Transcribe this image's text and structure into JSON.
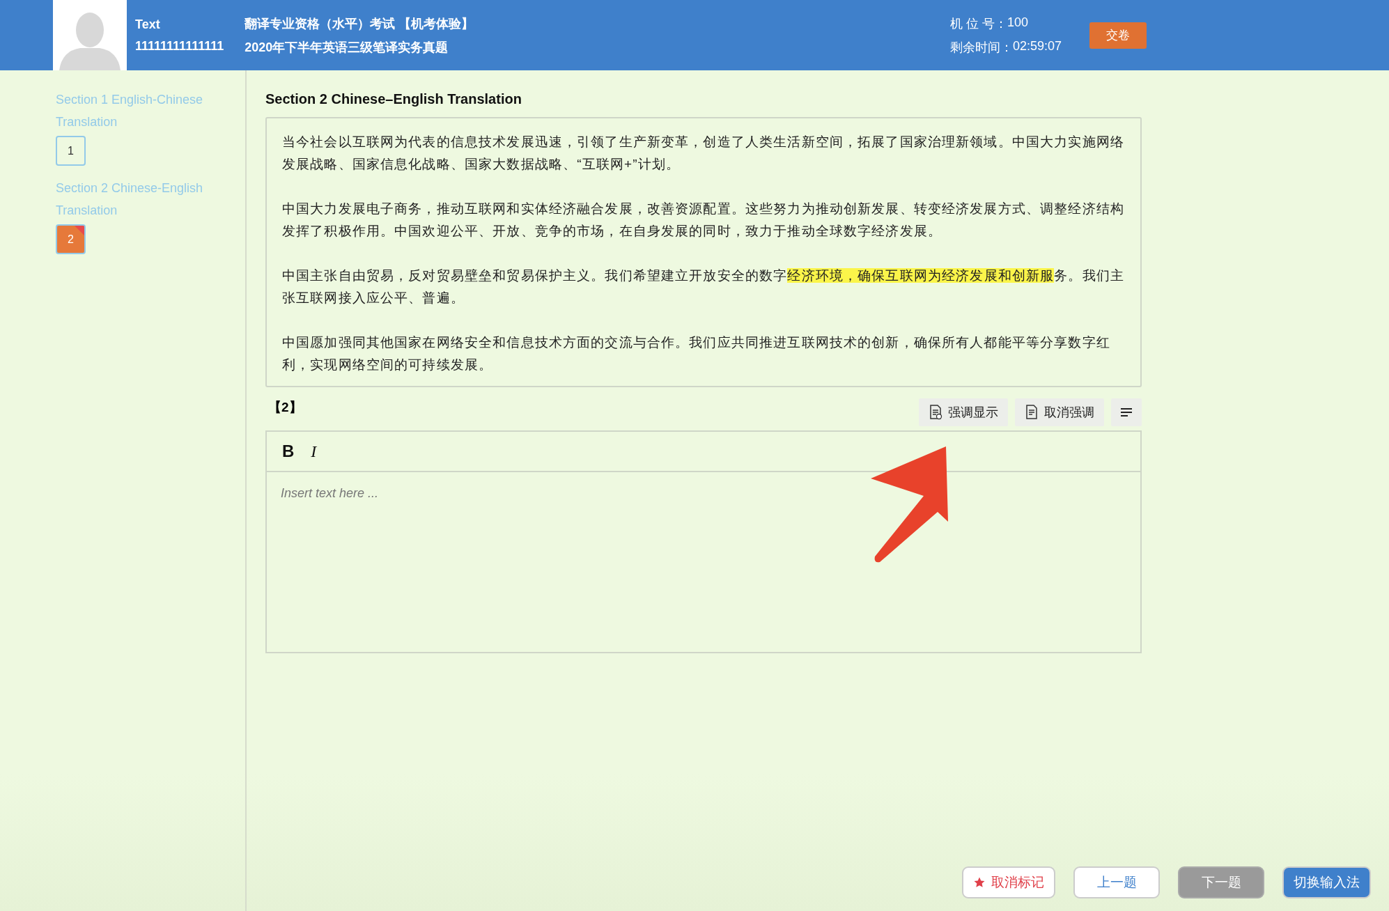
{
  "header": {
    "candidate_name": "Text",
    "candidate_id": "11111111111111",
    "exam_title": "翻译专业资格（水平）考试 【机考体验】",
    "paper_title": "2020年下半年英语三级笔译实务真题",
    "seat_label": "机 位 号：",
    "seat_number": "100",
    "time_label": "剩余时间：",
    "time_left": "02:59:07",
    "submit_button": "交卷"
  },
  "sidebar": {
    "sections": [
      {
        "title": "Section 1 English-Chinese Translation",
        "questions": [
          {
            "label": "1",
            "selected": false,
            "flagged": false
          }
        ]
      },
      {
        "title": "Section 2 Chinese-English Translation",
        "questions": [
          {
            "label": "2",
            "selected": true,
            "flagged": true
          }
        ]
      }
    ]
  },
  "question": {
    "section_title": "Section 2 Chinese–English Translation",
    "paragraphs": [
      [
        {
          "text": "当今社会以互联网为代表的信息技术发展迅速，引领了生产新变革，创造了人类生活新空间，拓展了国家治理新领域。中国大力实施网络发展战略、国家信息化战略、国家大数据战略、“互联网+”计划。",
          "highlighted": false
        }
      ],
      [
        {
          "text": "中国大力发展电子商务，推动互联网和实体经济融合发展，改善资源配置。这些努力为推动创新发展、转变经济发展方式、调整经济结构发挥了积极作用。中国欢迎公平、开放、竞争的市场，在自身发展的同时，致力于推动全球数字经济发展。",
          "highlighted": false
        }
      ],
      [
        {
          "text": "中国主张自由贸易，反对贸易壁垒和贸易保护主义。我们希望建立开放安全的数字",
          "highlighted": false
        },
        {
          "text": "经济环境，确保互联网为经济发展和创新服",
          "highlighted": true
        },
        {
          "text": "务。我们主张互联网接入应公平、普遍。",
          "highlighted": false
        }
      ],
      [
        {
          "text": "中国愿加强同其他国家在网络安全和信息技术方面的交流与合作。我们应共同推进互联网技术的创新，确保所有人都能平等分享数字红利，实现网络空间的可持续发展。",
          "highlighted": false
        }
      ]
    ],
    "answer_label": "【2】",
    "tools": [
      {
        "kind": "highlight",
        "label": "强调显示"
      },
      {
        "kind": "unhighlight",
        "label": "取消强调"
      },
      {
        "kind": "align"
      }
    ],
    "editor": {
      "format_buttons": [
        {
          "kind": "bold",
          "label": "B"
        },
        {
          "kind": "italic",
          "label": "I"
        }
      ],
      "placeholder": "Insert text here ..."
    }
  },
  "footer_buttons": [
    {
      "kind": "flag",
      "label": "取消标记",
      "disabled": false
    },
    {
      "kind": "plain",
      "label": "上一题",
      "disabled": false
    },
    {
      "kind": "plain",
      "label": "下一题",
      "disabled": true
    },
    {
      "kind": "primary",
      "label": "切换输入法",
      "disabled": false
    }
  ]
}
